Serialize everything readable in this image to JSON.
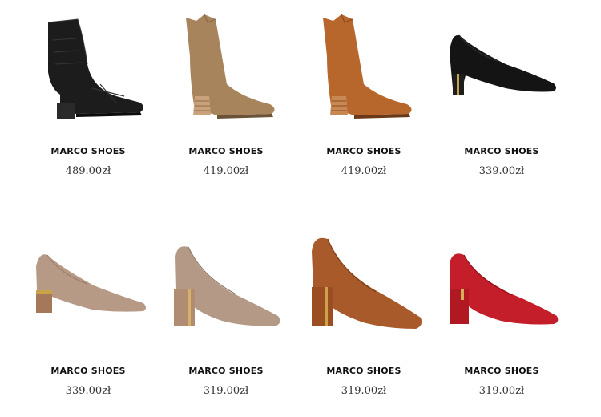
{
  "products": [
    {
      "brand": "MARCO SHOES",
      "price": "489.00zł",
      "icon": "black-ankle-boot-icon",
      "color": "#1c1c1c"
    },
    {
      "brand": "MARCO SHOES",
      "price": "419.00zł",
      "icon": "taupe-cowboy-boot-icon",
      "color": "#a8845c"
    },
    {
      "brand": "MARCO SHOES",
      "price": "419.00zł",
      "icon": "cognac-cowboy-boot-icon",
      "color": "#b8672c"
    },
    {
      "brand": "MARCO SHOES",
      "price": "339.00zł",
      "icon": "black-pump-icon",
      "color": "#141414"
    },
    {
      "brand": "MARCO SHOES",
      "price": "339.00zł",
      "icon": "beige-pump-icon",
      "color": "#b79a85"
    },
    {
      "brand": "MARCO SHOES",
      "price": "319.00zł",
      "icon": "taupe-pump-icon",
      "color": "#b49a86"
    },
    {
      "brand": "MARCO SHOES",
      "price": "319.00zł",
      "icon": "cognac-pump-icon",
      "color": "#a85a2a"
    },
    {
      "brand": "MARCO SHOES",
      "price": "319.00zł",
      "icon": "red-pump-icon",
      "color": "#c41e2a"
    }
  ]
}
